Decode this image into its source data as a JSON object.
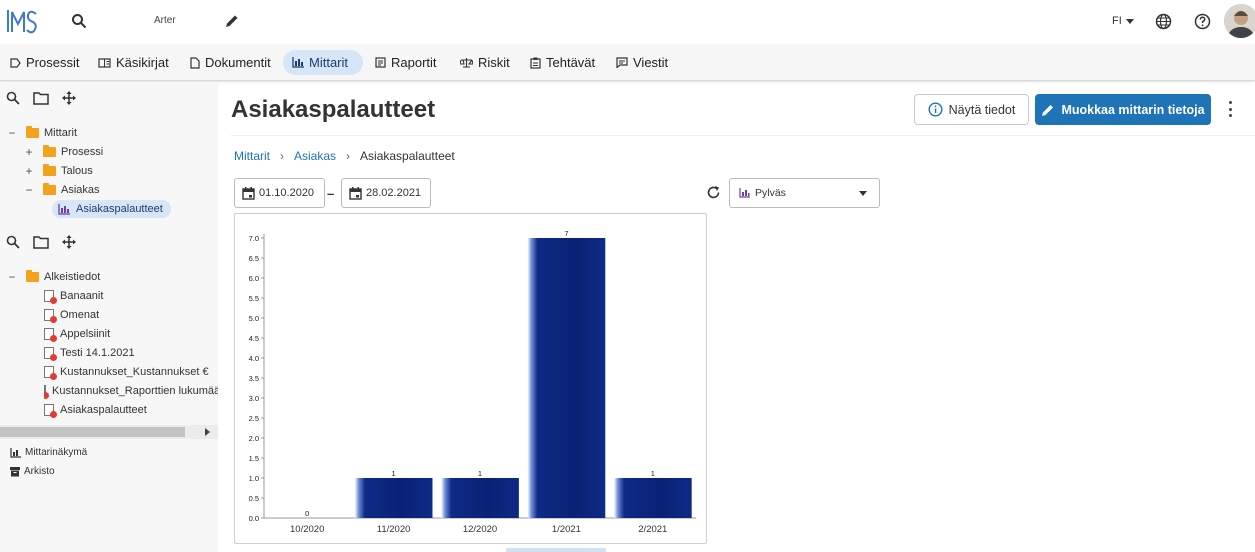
{
  "topbar": {
    "search_icon": "search-icon",
    "search_text": "Arter",
    "edit_icon": "pencil-icon",
    "language": "FI",
    "globe_icon": "globe-icon",
    "help_icon": "help-icon"
  },
  "nav": {
    "items": [
      {
        "label": "Prosessit",
        "icon": "process-icon"
      },
      {
        "label": "Käsikirjat",
        "icon": "handbook-icon"
      },
      {
        "label": "Dokumentit",
        "icon": "document-icon"
      },
      {
        "label": "Mittarit",
        "icon": "bar-chart-icon",
        "active": true
      },
      {
        "label": "Raportit",
        "icon": "report-icon"
      },
      {
        "label": "Riskit",
        "icon": "scale-icon"
      },
      {
        "label": "Tehtävät",
        "icon": "task-icon"
      },
      {
        "label": "Viestit",
        "icon": "message-icon"
      }
    ]
  },
  "sidebar": {
    "tree1": {
      "root": "Mittarit",
      "children": [
        "Prosessi",
        "Talous",
        "Asiakas"
      ],
      "leaf": "Asiakaspalautteet"
    },
    "tree2": {
      "root": "Alkeistiedot",
      "items": [
        "Banaanit",
        "Omenat",
        "Appelsiinit",
        "Testi 14.1.2021",
        "Kustannukset_Kustannukset €",
        "Kustannukset_Raporttien lukumää",
        "Asiakaspalautteet"
      ]
    },
    "bottom_links": [
      "Mittarinäkymä",
      "Arkisto"
    ]
  },
  "main": {
    "title": "Asiakaspalautteet",
    "show_info_label": "Näytä tiedot",
    "edit_label": "Muokkaa mittarin tietoja",
    "breadcrumb": [
      "Mittarit",
      "Asiakas",
      "Asiakaspalautteet"
    ],
    "date_start": "01.10.2020",
    "date_end": "28.02.2021",
    "chart_type_select": "Pylväs"
  },
  "colors": {
    "accent": "#1f73b7",
    "active_tab_bg": "#d7e6f6",
    "bar": "#0d2a86",
    "folder": "#f2a21b"
  },
  "chart_data": {
    "type": "bar",
    "categories": [
      "10/2020",
      "11/2020",
      "12/2020",
      "1/2021",
      "2/2021"
    ],
    "values": [
      0,
      1,
      1,
      7,
      1
    ],
    "data_labels": [
      "0",
      "1",
      "1",
      "7",
      "1"
    ],
    "yticks": [
      "0.0",
      "0.5",
      "1.0",
      "1.5",
      "2.0",
      "2.5",
      "3.0",
      "3.5",
      "4.0",
      "4.5",
      "5.0",
      "5.5",
      "6.0",
      "6.5",
      "7.0"
    ],
    "ylim": [
      0,
      7
    ],
    "grid": false,
    "legend": "none"
  }
}
